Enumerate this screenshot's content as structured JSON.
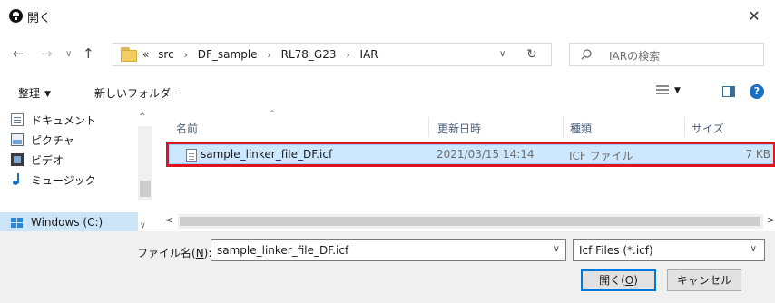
{
  "window": {
    "title": "開く",
    "close_label": "✕"
  },
  "nav": {
    "back": "←",
    "forward": "→",
    "recent": "∨",
    "up": "↑"
  },
  "address": {
    "overflow": "«",
    "crumbs": [
      "src",
      "DF_sample",
      "RL78_G23",
      "IAR"
    ],
    "separator": "›",
    "dropdown": "∨",
    "refresh": "↻"
  },
  "search": {
    "placeholder": "IARの検索"
  },
  "toolbar": {
    "organize": "整理",
    "organize_caret": "▼",
    "new_folder": "新しいフォルダー",
    "view_caret": "▼",
    "help": "?"
  },
  "sidebar": {
    "items": [
      {
        "label": "ドキュメント",
        "icon": "document-icon"
      },
      {
        "label": "ピクチャ",
        "icon": "picture-icon"
      },
      {
        "label": "ビデオ",
        "icon": "video-icon"
      },
      {
        "label": "ミュージック",
        "icon": "music-icon"
      },
      {
        "label": "Windows (C:)",
        "icon": "drive-icon"
      }
    ],
    "scroll_up": "^",
    "scroll_down": "∨"
  },
  "columns": {
    "name": "名前",
    "modified": "更新日時",
    "type": "種類",
    "size": "サイズ",
    "sort_indicator": "^"
  },
  "files": [
    {
      "name": "sample_linker_file_DF.icf",
      "modified": "2021/03/15 14:14",
      "type": "ICF ファイル",
      "size": "7 KB"
    }
  ],
  "hscroll": {
    "left": "<",
    "right": ">"
  },
  "footer": {
    "filename_label_prefix": "ファイル名(",
    "filename_label_key": "N",
    "filename_label_suffix": "):",
    "filename_value": "sample_linker_file_DF.icf",
    "filter_value": "Icf Files (*.icf)",
    "dropdown": "∨",
    "open_prefix": "開く(",
    "open_key": "O",
    "open_suffix": ")",
    "cancel": "キャンセル"
  },
  "colors": {
    "accent": "#0078d7",
    "selection": "#cce8ff",
    "highlight": "#e0141e"
  }
}
